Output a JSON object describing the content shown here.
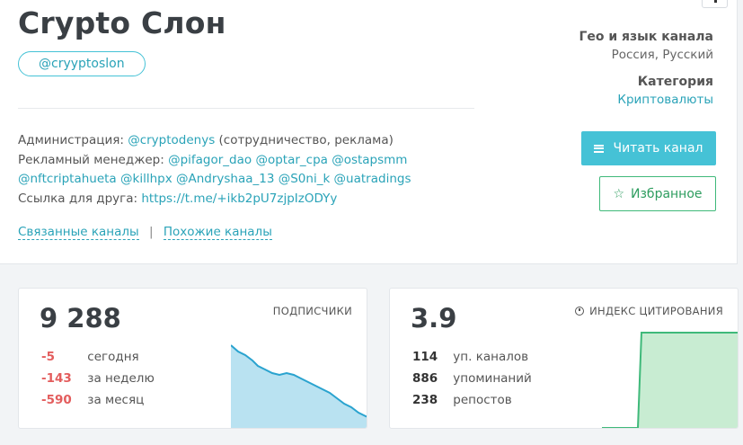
{
  "channel": {
    "title": "Crypto Слон",
    "handle": "@cryyptoslon"
  },
  "info": {
    "admin_label": "Администрация:",
    "admin_link": "@cryptodenys",
    "admin_note": "(сотрудничество, реклама)",
    "manager_label": "Рекламный менеджер:",
    "manager_links_line1": "@pifagor_dao @optar_cpa @ostapsmm",
    "manager_links_line2": "@nftcriptahueta @killhpx @Andryshaa_13 @S0ni_k @uatradings",
    "friend_label": "Ссылка для друга:",
    "friend_link": "https://t.me/+ikb2pU7zjpIzODYy"
  },
  "related": {
    "related_label": "Связанные каналы",
    "separator": "|",
    "similar_label": "Похожие каналы"
  },
  "sidebar": {
    "geo_label": "Гео и язык канала",
    "geo_value": "Россия, Русский",
    "category_label": "Категория",
    "category_value": "Криптовалюты",
    "read_button": "Читать канал",
    "favorite_button": "Избранное"
  },
  "subscribers": {
    "value": "9 288",
    "label": "ПОДПИСЧИКИ",
    "rows": [
      {
        "delta": "-5",
        "text": "сегодня"
      },
      {
        "delta": "-143",
        "text": "за неделю"
      },
      {
        "delta": "-590",
        "text": "за месяц"
      }
    ],
    "chart_color": "#2aa3cf",
    "chart_fill": "#b9e2f1"
  },
  "citation": {
    "value": "3.9",
    "label": "ИНДЕКС ЦИТИРОВАНИЯ",
    "rows": [
      {
        "count": "114",
        "text": "уп. каналов"
      },
      {
        "count": "886",
        "text": "упоминаний"
      },
      {
        "count": "238",
        "text": "репостов"
      }
    ],
    "chart_color": "#3fb97a",
    "chart_fill": "#c8ecd2"
  },
  "colors": {
    "accent": "#45c2d6",
    "link": "#2aa3b8",
    "favorite": "#3fb97a",
    "negative": "#e35d5d"
  }
}
